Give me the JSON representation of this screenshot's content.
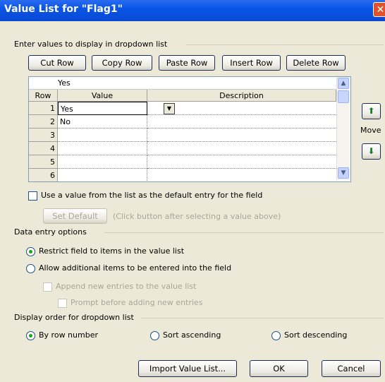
{
  "window": {
    "title": "Value List for \"Flag1\"",
    "close_glyph": "✕"
  },
  "section_values": {
    "label": "Enter values to display in dropdown list"
  },
  "toolbar": {
    "cut_row": "Cut Row",
    "copy_row": "Copy Row",
    "paste_row": "Paste Row",
    "insert_row": "Insert Row",
    "delete_row": "Delete Row"
  },
  "grid": {
    "current_edit_value": "Yes",
    "columns": {
      "row": "Row",
      "value": "Value",
      "description": "Description"
    },
    "rows": [
      {
        "num": "1",
        "value": "Yes",
        "description": ""
      },
      {
        "num": "2",
        "value": "No",
        "description": ""
      },
      {
        "num": "3",
        "value": "",
        "description": ""
      },
      {
        "num": "4",
        "value": "",
        "description": ""
      },
      {
        "num": "5",
        "value": "",
        "description": ""
      },
      {
        "num": "6",
        "value": "",
        "description": ""
      }
    ]
  },
  "move": {
    "label": "Move",
    "up_icon": "arrow-up-icon",
    "down_icon": "arrow-down-icon"
  },
  "default_entry": {
    "checkbox_label": "Use a value from the list as the default entry for the field",
    "checked": false,
    "set_default_label": "Set Default",
    "hint": "(Click button after selecting a value above)"
  },
  "data_entry": {
    "section_label": "Data entry options",
    "restrict_label": "Restrict field to items in the value list",
    "restrict_selected": true,
    "allow_label": "Allow additional items to be entered into the field",
    "append_label": "Append new entries to the value list",
    "prompt_label": "Prompt before adding new entries"
  },
  "display_order": {
    "section_label": "Display order for dropdown list",
    "by_row_label": "By row number",
    "sort_asc_label": "Sort ascending",
    "sort_desc_label": "Sort descending",
    "selected": "by_row"
  },
  "footer": {
    "import_label": "Import Value List...",
    "ok_label": "OK",
    "cancel_label": "Cancel"
  }
}
